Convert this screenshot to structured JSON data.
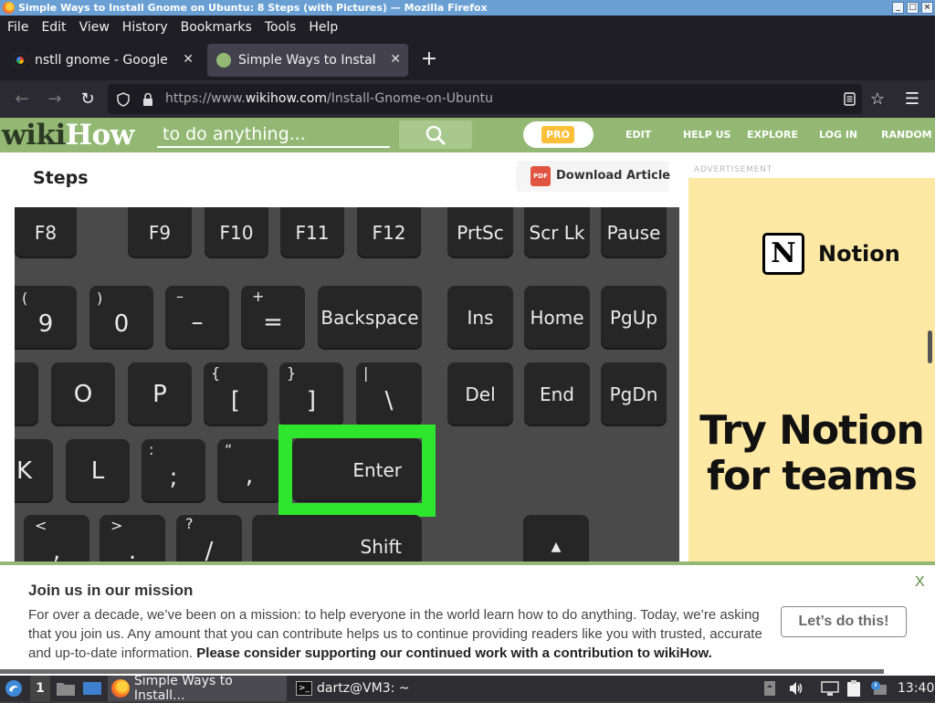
{
  "window": {
    "title": "Simple Ways to Install Gnome on Ubuntu: 8 Steps (with Pictures) — Mozilla Firefox"
  },
  "menu": {
    "items": [
      "File",
      "Edit",
      "View",
      "History",
      "Bookmarks",
      "Tools",
      "Help"
    ]
  },
  "tabs": [
    {
      "label": "nstll gnome - Google Sea",
      "active": false
    },
    {
      "label": "Simple Ways to Install Gr",
      "active": true
    }
  ],
  "url": {
    "prefix": "https://www.",
    "domain": "wikihow.com",
    "path": "/Install-Gnome-on-Ubuntu"
  },
  "site": {
    "logo_left": "wiki",
    "logo_right": "How",
    "search_placeholder": "to do anything...",
    "pro_label": "PRO",
    "nav": [
      "EDIT",
      "HELP US",
      "EXPLORE",
      "LOG IN",
      "RANDOM"
    ]
  },
  "article": {
    "section_title": "Steps",
    "download_label": "Download Article",
    "pdf_icon_text": "PDF"
  },
  "keyboard": {
    "row1": [
      "F8",
      "F9",
      "F10",
      "F11",
      "F12",
      "PrtSc",
      "Scr Lk",
      "Pause"
    ],
    "row2": [
      {
        "main": "9",
        "shift": "("
      },
      {
        "main": "0",
        "shift": ")"
      },
      {
        "main": "–",
        "shift": "–"
      },
      {
        "main": "=",
        "shift": "+"
      },
      {
        "main": "Backspace"
      },
      {
        "main": "Ins"
      },
      {
        "main": "Home"
      },
      {
        "main": "PgUp"
      }
    ],
    "row3": [
      {
        "main": "O"
      },
      {
        "main": "P"
      },
      {
        "main": "[",
        "shift": "{"
      },
      {
        "main": "]",
        "shift": "}"
      },
      {
        "main": "\\",
        "shift": "|"
      },
      {
        "main": "Del"
      },
      {
        "main": "End"
      },
      {
        "main": "PgDn"
      }
    ],
    "row4": [
      {
        "main": "K"
      },
      {
        "main": "L"
      },
      {
        "main": ";",
        "shift": ":"
      },
      {
        "main": ",",
        "shift": "“"
      },
      {
        "main": "Enter"
      }
    ],
    "row5": [
      {
        "main": ",",
        "shift": "<"
      },
      {
        "main": ".",
        "shift": ">"
      },
      {
        "main": "/",
        "shift": "?"
      },
      {
        "main": "Shift"
      },
      {
        "main": "▲"
      }
    ],
    "highlight_color": "#2ee62e"
  },
  "ad": {
    "label": "ADVERTISEMENT",
    "brand_glyph": "N",
    "brand": "Notion",
    "cta_line1": "Try Notion",
    "cta_line2": "for teams"
  },
  "banner": {
    "title": "Join us in our mission",
    "body": "For over a decade, we’ve been on a mission: to help everyone in the world learn how to do anything. Today, we’re asking that you join us. Any amount that you can contribute helps us to continue providing readers like you with trusted, accurate and up-to-date information.",
    "body_bold": "Please consider supporting our continued work with a contribution to wikiHow.",
    "button": "Let’s do this!",
    "close": "X"
  },
  "taskbar": {
    "workspace": "1",
    "apps": [
      {
        "label": "Simple Ways to Install...",
        "icon": "firefox-icon"
      },
      {
        "label": "dartz@VM3: ~",
        "icon": "terminal-icon"
      }
    ],
    "clock": "13:40"
  },
  "colors": {
    "wikihow_green": "#93b874",
    "pro_orange": "#fbbf3a",
    "ad_background": "#fde9a4"
  }
}
